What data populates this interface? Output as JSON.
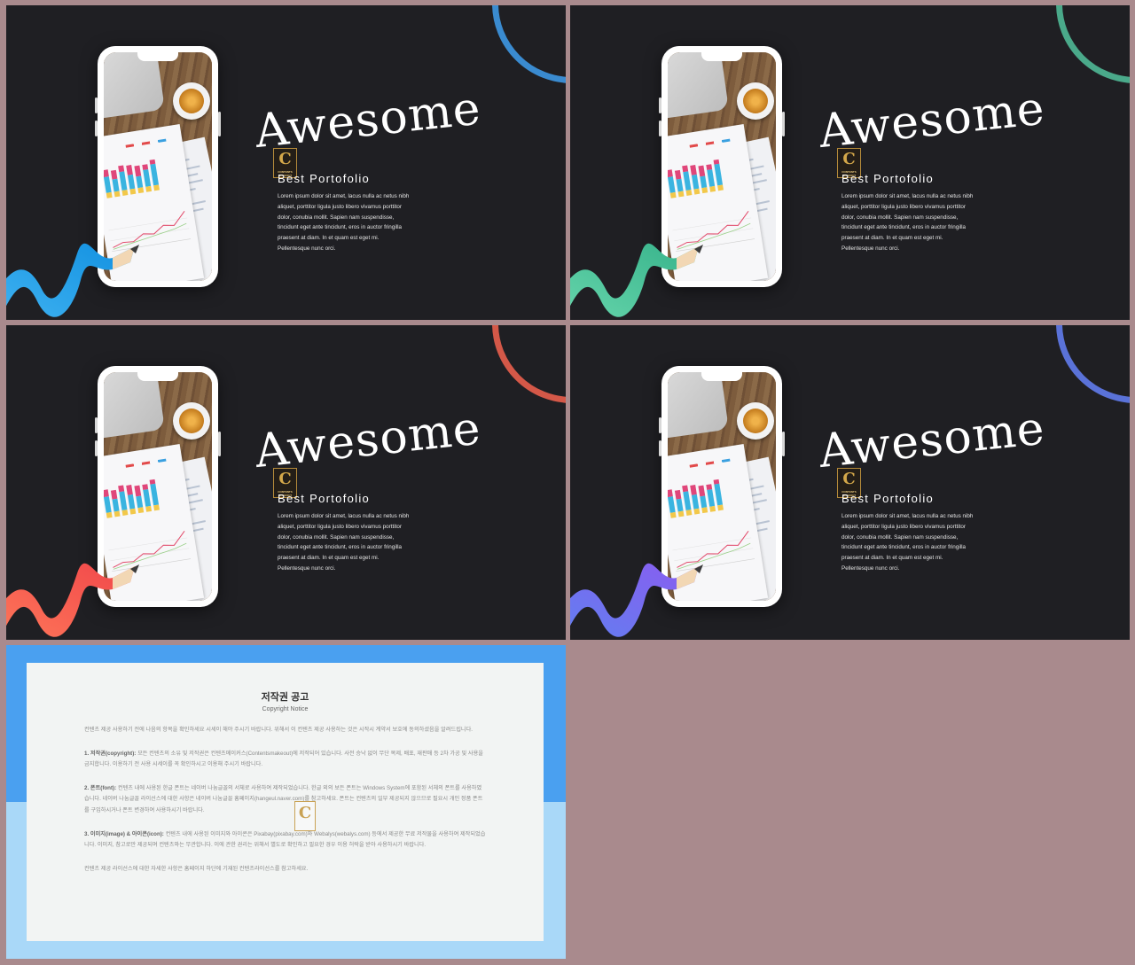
{
  "slides": [
    {
      "id": "s1",
      "accent_dark": "#1190e0",
      "accent_light": "#42b4f2",
      "arc_color": "#3a8bd0"
    },
    {
      "id": "s2",
      "accent_dark": "#36b28a",
      "accent_light": "#6ad8ae",
      "arc_color": "#4aa98a"
    },
    {
      "id": "s3",
      "accent_dark": "#f0464a",
      "accent_light": "#ff7a5a",
      "arc_color": "#d45848"
    },
    {
      "id": "s4",
      "accent_dark": "#8a5cf0",
      "accent_light": "#5e82f0",
      "arc_color": "#5a72d8"
    }
  ],
  "slide_text": {
    "title": "Awesome",
    "subtitle": "Best Portofolio",
    "body": "Lorem ipsum dolor sit amet, lacus nulla ac netus nibh aliquet, porttitor ligula justo libero vivamus porttitor dolor, conubia mollit. Sapien nam suspendisse, tincidunt eget ante tincidunt, eros in auctor fringilla praesent at diam. In et quam est eget mi. Pellentesque nunc orci.",
    "logo_letter": "C",
    "logo_text": "CONTENTS MAKEOUT"
  },
  "notice": {
    "title": "저작권 공고",
    "subtitle": "Copyright Notice",
    "intro": "컨텐츠 제공 사용하기 전에 나음의 항목을 확인하세요 시세이 해야 주시기 바랍니다. 위해서 이 컨텐츠 제공 사용하는 것은 시작시 계약서 보호에 동의하셨음을 알려드립니다.",
    "sections": [
      {
        "head": "1. 저작권(copyright):",
        "text": "모든 컨텐츠의 소유 및 저작권은 컨텐츠메이커스(Contentsmakeout)에 저작되어 있습니다. 사전 승낙 없이 무단 복제, 배포, 재판매 등 2차 가공 및 사용을 금지합니다. 이용하기 전 사용 시세이를 꼭 확인하시고 이용해 주시기 바랍니다."
      },
      {
        "head": "2. 폰트(font):",
        "text": "컨텐츠 내에 사용된 한글 폰트는 네이버 나눔글꼴의 서체로 사용하여 제작되었습니다. 한글 외의 보든 폰트는 Windows System에 포함된 서체의 폰트를 사용하였습니다. 네이버 나눔글꼴 라이선스에 대한 사항은 네이버 나눔글꼴 홈페이지(hangeul.naver.com)를 참고하세요. 폰트는 컨텐츠의 일부 제공되지 않으므로 필요시 개인 정품 폰트를 구입하시거나 폰트 변경하여 사용하시기 바랍니다."
      },
      {
        "head": "3. 이미지(image) & 아이콘(icon):",
        "text": "컨텐츠 내에 사용된 이미지와 아이콘은 Pixabay(pixabay.com)와 Webalys(webalys.com) 등에서 제공한 무료 저작물을 사용하여 제작되었습니다. 이미지, 참고로만 제공되며 컨텐츠와는 무관합니다. 이에 관한 권리는 위해서 별도로 확인하고 필요한 경우 이용 허락을 받아 사용하시기 바랍니다."
      }
    ],
    "footer": "컨텐츠 제공 라이선스에 대한 자세한 사항은 홈페이지 하단에 기재된 컨텐츠라이선스를 참고하세요."
  }
}
